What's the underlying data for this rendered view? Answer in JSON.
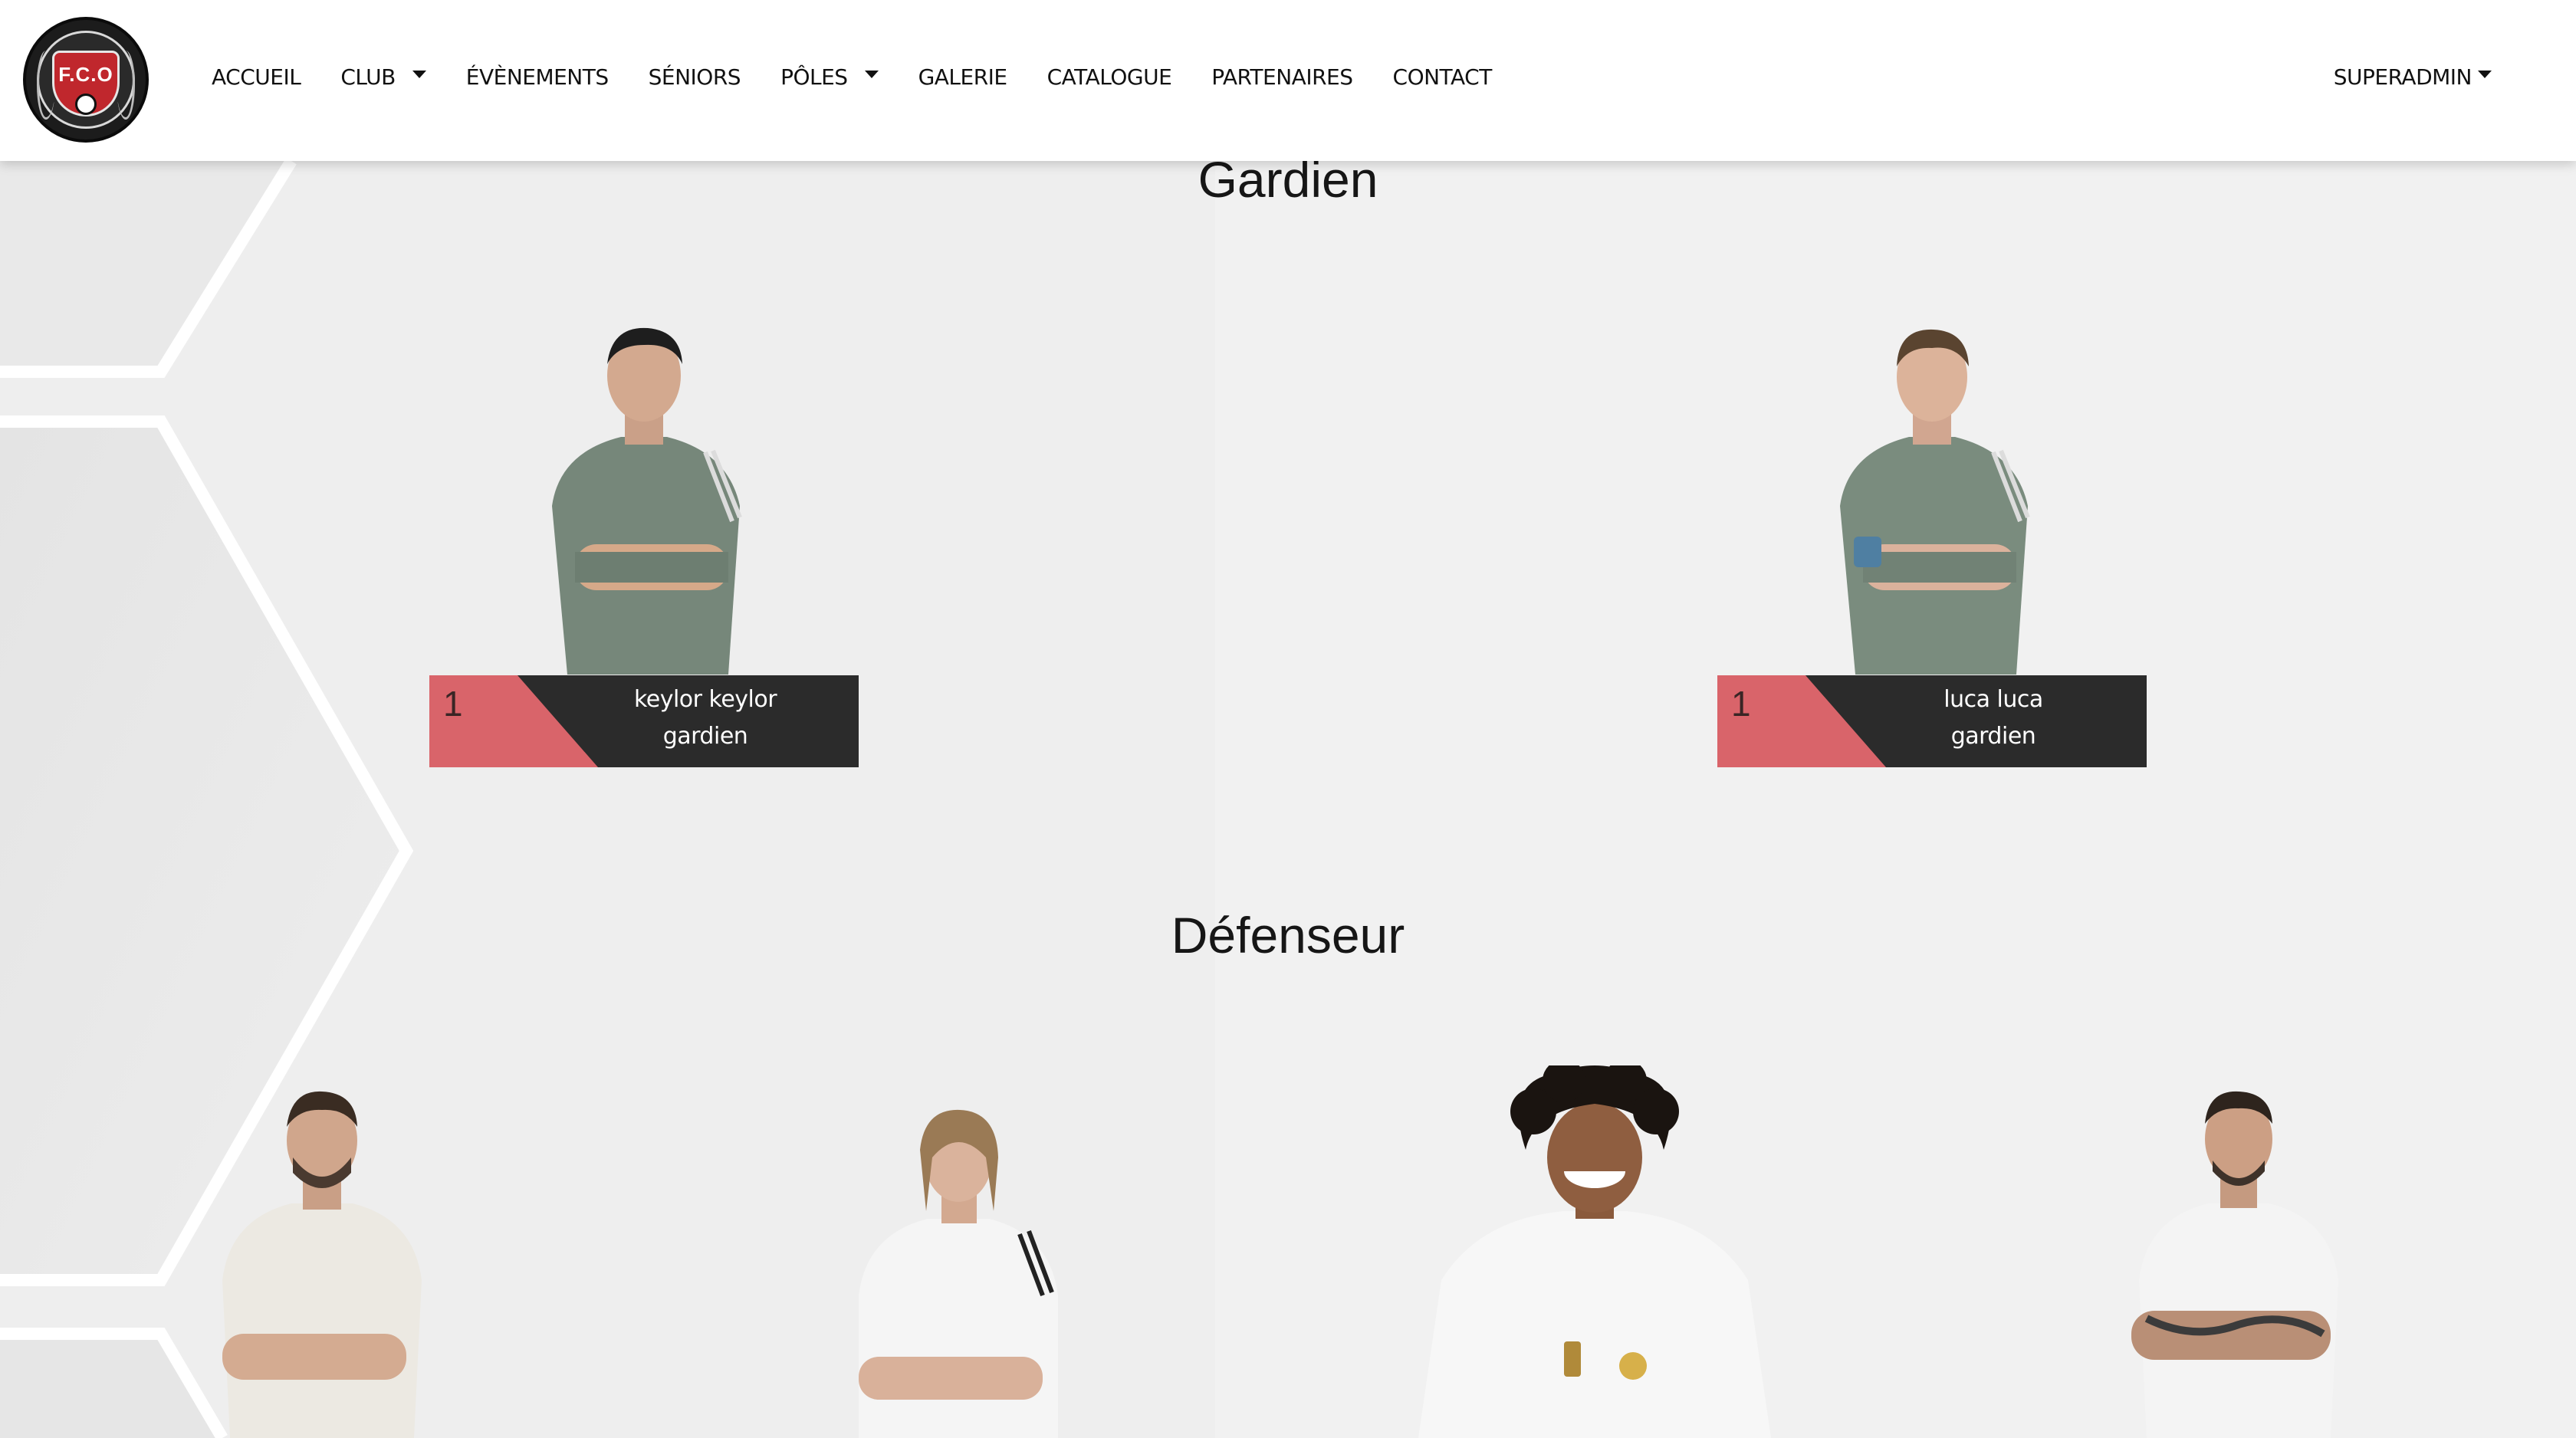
{
  "brand": {
    "logo_text": "F.C.O",
    "colors": {
      "accent_red": "#d9646a",
      "dark": "#2b2b2b",
      "navbar_bg": "#ffffff"
    }
  },
  "nav": {
    "items": [
      {
        "label": "ACCUEIL",
        "dropdown": false
      },
      {
        "label": "CLUB",
        "dropdown": true
      },
      {
        "label": "ÉVÈNEMENTS",
        "dropdown": false
      },
      {
        "label": "SÉNIORS",
        "dropdown": false
      },
      {
        "label": "PÔLES",
        "dropdown": true
      },
      {
        "label": "GALERIE",
        "dropdown": false
      },
      {
        "label": "CATALOGUE",
        "dropdown": false
      },
      {
        "label": "PARTENAIRES",
        "dropdown": false
      },
      {
        "label": "CONTACT",
        "dropdown": false
      }
    ],
    "user_menu": "SUPERADMIN"
  },
  "sections": [
    {
      "title": "Gardien",
      "players": [
        {
          "number": "1",
          "name": "keylor keylor",
          "role": "gardien",
          "kit": "green"
        },
        {
          "number": "1",
          "name": "luca luca",
          "role": "gardien",
          "kit": "green"
        }
      ]
    },
    {
      "title": "Défenseur",
      "players": [
        {
          "kit": "white"
        },
        {
          "kit": "white"
        },
        {
          "kit": "white"
        },
        {
          "kit": "white"
        }
      ]
    }
  ]
}
